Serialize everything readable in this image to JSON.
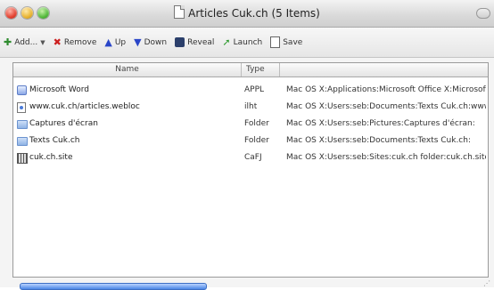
{
  "window": {
    "title": "Articles Cuk.ch (5 Items)"
  },
  "toolbar": {
    "add_label": "Add...",
    "remove_label": "Remove",
    "up_label": "Up",
    "down_label": "Down",
    "reveal_label": "Reveal",
    "launch_label": "Launch",
    "save_label": "Save"
  },
  "table": {
    "columns": [
      "Name",
      "Type",
      ""
    ],
    "rows": [
      {
        "name": "Microsoft Word",
        "type": "APPL",
        "path": "Mac OS X:Applications:Microsoft Office X:Microsoft",
        "icon": "application-icon"
      },
      {
        "name": "www.cuk.ch/articles.webloc",
        "type": "ilht",
        "path": "Mac OS X:Users:seb:Documents:Texts Cuk.ch:www.",
        "icon": "webloc-icon"
      },
      {
        "name": "Captures d'écran",
        "type": "Folder",
        "path": "Mac OS X:Users:seb:Pictures:Captures d'écran:",
        "icon": "folder-icon"
      },
      {
        "name": "Texts Cuk.ch",
        "type": "Folder",
        "path": "Mac OS X:Users:seb:Documents:Texts Cuk.ch:",
        "icon": "folder-icon"
      },
      {
        "name": "cuk.ch.site",
        "type": "CaFJ",
        "path": "Mac OS X:Users:seb:Sites:cuk.ch folder:cuk.ch.site",
        "icon": "site-file-icon"
      }
    ]
  }
}
